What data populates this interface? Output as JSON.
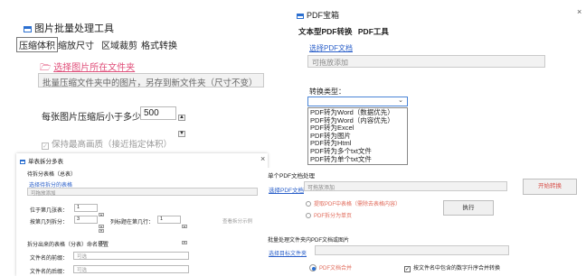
{
  "image_tool": {
    "title": "图片批量处理工具",
    "tabs": [
      "压缩体积",
      "缩放尺寸",
      "区域裁剪",
      "格式转换"
    ],
    "select_folder_link": "选择图片所在文件夹",
    "folder_placeholder": "批量压缩文件夹中的图片，另存到新文件夹（尺寸不变）",
    "size_label": "每张图片压缩后小于多少KB：",
    "size_value": "500",
    "keep_quality_label": "保持最高画质（接近指定体积）"
  },
  "pdf_tool": {
    "title": "PDF宝箱",
    "close": "×",
    "tabs": [
      "文本型PDF转换",
      "PDF工具"
    ],
    "select_doc_link": "选择PDF文档",
    "drop_hint": "可拖放添加",
    "convert_type_label": "转换类型：",
    "dropdown_options": [
      "PDF转为Word（数据优先）",
      "PDF转为Word（内容优先）",
      "PDF转为Excel",
      "PDF转为图片",
      "PDF转为Html",
      "PDF转为多个txt文件",
      "PDF转为单个txt文件"
    ]
  },
  "split_tool": {
    "title": "单表拆分多表",
    "close": "×",
    "section1_title": "待拆分表格（总表）",
    "select_table_link": "选择待拆分的表格",
    "drop_hint": "可拖放添加",
    "header_row_label": "位于第几张表：",
    "header_row_value": "1",
    "split_col_label": "按第几列拆分：",
    "split_col_value": "3",
    "list_col_label": "列标题在第几行：",
    "list_col_value": "1",
    "view_example": "查看拆分示例",
    "section2_title": "拆分出来的表格（分表）命名设置",
    "prefix_label": "文件名的前缀：",
    "prefix_value": "可选",
    "suffix_label": "文件名的后缀：",
    "suffix_value": "可选"
  },
  "single_pdf": {
    "section_title": "单个PDF文档处理",
    "select_doc_link": "选择PDF文档",
    "drop_hint": "可拖放添加",
    "start_convert": "开始转换",
    "option1": "提取PDF中表格（需除去表格内容）",
    "option2": "PDF拆分为单页",
    "execute_label": "执行",
    "batch_title": "批量处理文件夹内PDF文档或图片",
    "select_folder_link": "选择目标文件夹",
    "merge_label": "PDF文档合并",
    "sort_label": "按文件名中包含的数字升序合并转换"
  }
}
